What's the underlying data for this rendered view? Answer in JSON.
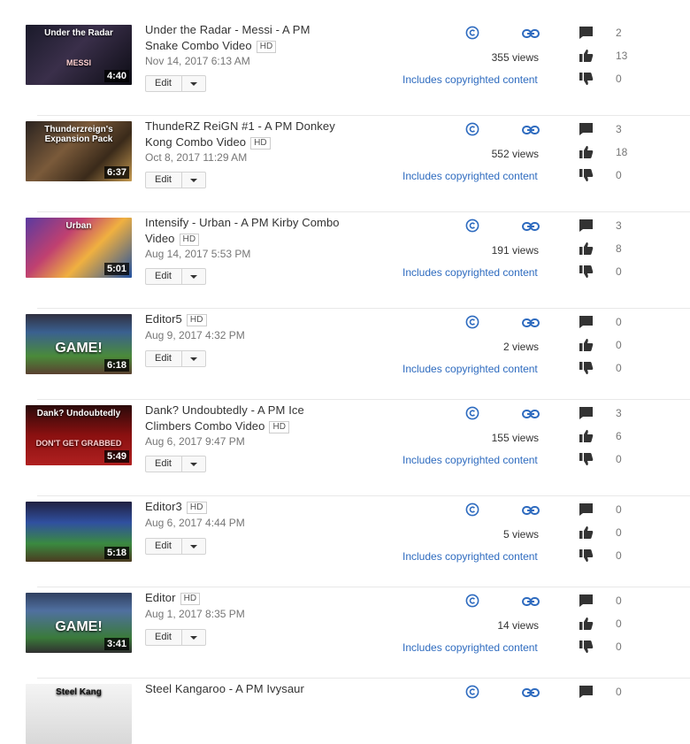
{
  "ui": {
    "hd_label": "HD",
    "edit_label": "Edit",
    "copyright_text": "Includes copyrighted content"
  },
  "colors": {
    "link": "#2e6bbf",
    "icon_blue": "#2e6bbf",
    "icon_dark": "#333333"
  },
  "videos": [
    {
      "title_lines": [
        "Under the Radar - Messi - A PM",
        "Snake Combo Video"
      ],
      "hd": true,
      "date": "Nov 14, 2017 6:13 AM",
      "views": "355 views",
      "comments": "2",
      "likes": "13",
      "dislikes": "0",
      "duration": "4:40",
      "thumb_caption": "Under the Radar",
      "thumb_caption2": "MESSI"
    },
    {
      "title_lines": [
        "ThundeRZ ReiGN #1 - A PM Donkey",
        "Kong Combo Video"
      ],
      "hd": true,
      "date": "Oct 8, 2017 11:29 AM",
      "views": "552 views",
      "comments": "3",
      "likes": "18",
      "dislikes": "0",
      "duration": "6:37",
      "thumb_caption": "Thunderzreign's Expansion Pack",
      "thumb_caption2": ""
    },
    {
      "title_lines": [
        "Intensify - Urban - A PM Kirby Combo",
        "Video"
      ],
      "hd": true,
      "date": "Aug 14, 2017 5:53 PM",
      "views": "191 views",
      "comments": "3",
      "likes": "8",
      "dislikes": "0",
      "duration": "5:01",
      "thumb_caption": "Urban",
      "thumb_caption2": ""
    },
    {
      "title_lines": [
        "Editor5"
      ],
      "hd": true,
      "date": "Aug 9, 2017 4:32 PM",
      "views": "2 views",
      "comments": "0",
      "likes": "0",
      "dislikes": "0",
      "duration": "6:18",
      "thumb_caption": "GAME!",
      "thumb_caption2": ""
    },
    {
      "title_lines": [
        "Dank? Undoubtedly - A PM Ice",
        "Climbers Combo Video"
      ],
      "hd": true,
      "date": "Aug 6, 2017 9:47 PM",
      "views": "155 views",
      "comments": "3",
      "likes": "6",
      "dislikes": "0",
      "duration": "5:49",
      "thumb_caption": "Dank?  Undoubtedly",
      "thumb_caption2": "DON'T GET GRABBED"
    },
    {
      "title_lines": [
        "Editor3"
      ],
      "hd": true,
      "date": "Aug 6, 2017 4:44 PM",
      "views": "5 views",
      "comments": "0",
      "likes": "0",
      "dislikes": "0",
      "duration": "5:18",
      "thumb_caption": "",
      "thumb_caption2": ""
    },
    {
      "title_lines": [
        "Editor"
      ],
      "hd": true,
      "date": "Aug 1, 2017 8:35 PM",
      "views": "14 views",
      "comments": "0",
      "likes": "0",
      "dislikes": "0",
      "duration": "3:41",
      "thumb_caption": "GAME!",
      "thumb_caption2": ""
    },
    {
      "title_lines": [
        "Steel Kangaroo - A PM Ivysaur"
      ],
      "hd": false,
      "date": "",
      "views": "",
      "comments": "0",
      "likes": "",
      "dislikes": "",
      "duration": "",
      "thumb_caption": "Steel Kang",
      "thumb_caption2": ""
    }
  ]
}
